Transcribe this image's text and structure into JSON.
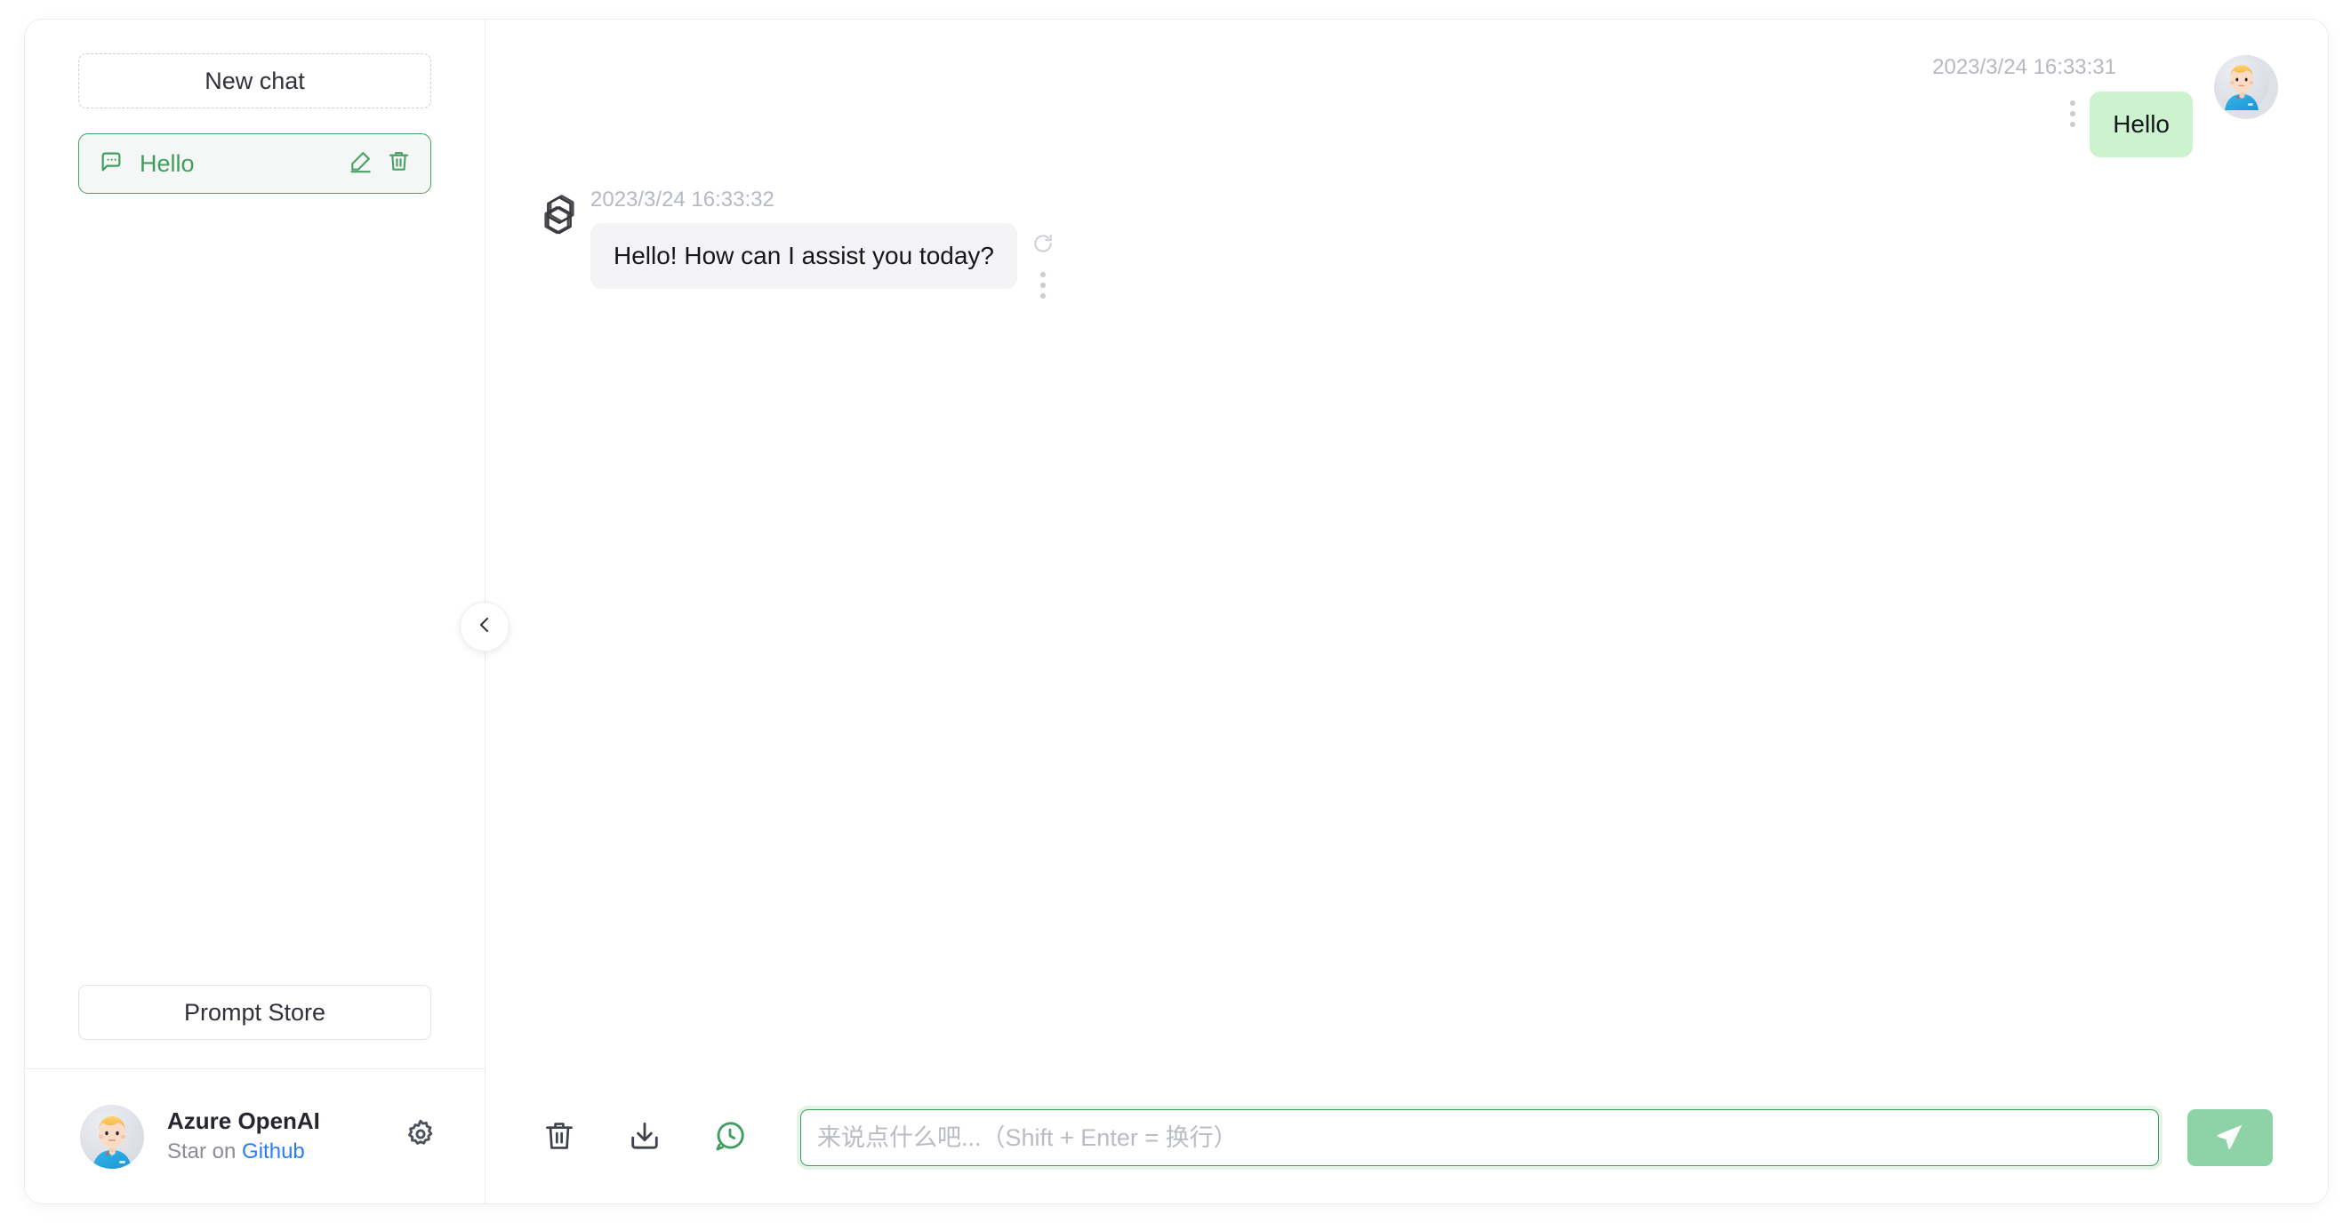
{
  "sidebar": {
    "new_chat_label": "New chat",
    "chats": [
      {
        "title": "Hello",
        "icon": "chat-bubble-icon",
        "edit_icon": "pencil-icon",
        "delete_icon": "trash-icon",
        "active": true
      }
    ],
    "prompt_store_label": "Prompt Store",
    "profile": {
      "name": "Azure OpenAI",
      "subtitle_prefix": "Star on ",
      "link_label": "Github",
      "avatar_icon": "user-avatar",
      "settings_icon": "gear-icon"
    },
    "collapse_icon": "chevron-left-icon"
  },
  "conversation": {
    "messages": [
      {
        "role": "user",
        "time": "2023/3/24 16:33:31",
        "text": "Hello",
        "avatar_icon": "user-avatar",
        "menu_icon": "more-vertical-icon"
      },
      {
        "role": "assistant",
        "time": "2023/3/24 16:33:32",
        "text": "Hello! How can I assist you today?",
        "avatar_icon": "openai-logo-icon",
        "regenerate_icon": "refresh-icon",
        "menu_icon": "more-vertical-icon"
      }
    ]
  },
  "composer": {
    "clear_icon": "trash-icon",
    "export_icon": "download-icon",
    "history_icon": "chat-history-icon",
    "placeholder": "来说点什么吧...（Shift + Enter = 换行）",
    "value": "",
    "send_icon": "send-plane-icon"
  },
  "colors": {
    "accent_green": "#3fa05e",
    "user_bubble": "#cdf2ce",
    "assistant_bubble": "#f4f4f6",
    "send_button": "#8ed2a7",
    "link_blue": "#2b7cf6",
    "timestamp_gray": "#b6b9c2"
  }
}
